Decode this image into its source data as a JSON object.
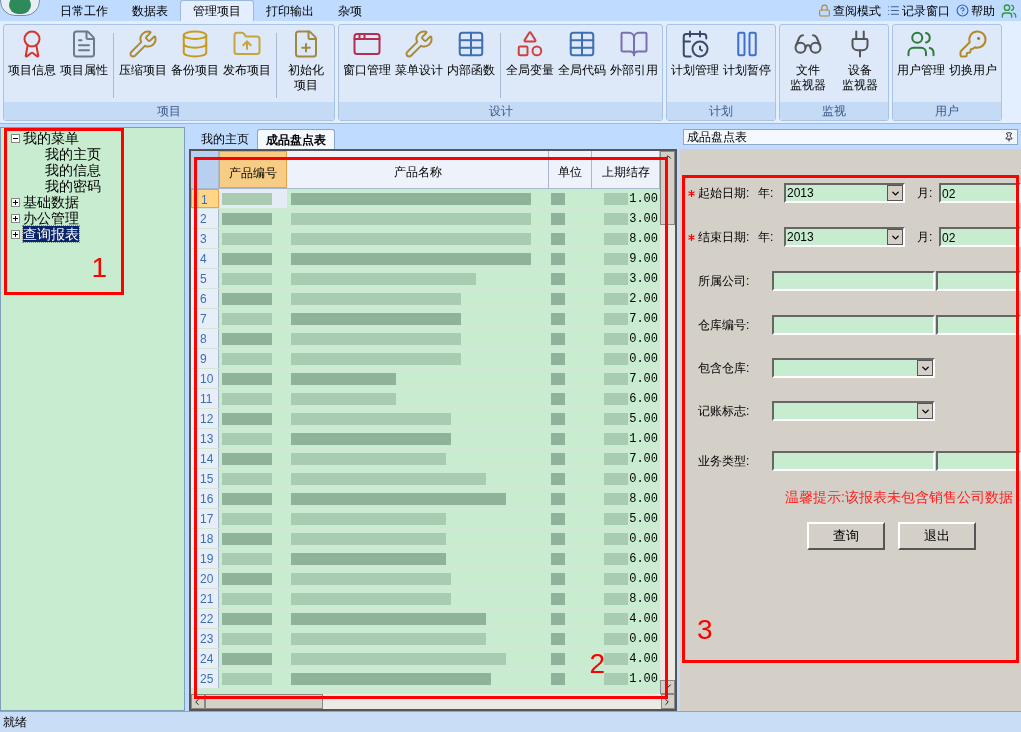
{
  "menu_tabs": [
    {
      "label": "日常工作",
      "selected": false
    },
    {
      "label": "数据表",
      "selected": false
    },
    {
      "label": "管理项目",
      "selected": true
    },
    {
      "label": "打印输出",
      "selected": false
    },
    {
      "label": "杂项",
      "selected": false
    }
  ],
  "top_links": [
    "查阅模式",
    "记录窗口",
    "帮助"
  ],
  "ribbon_groups": [
    {
      "label": "项目",
      "clusters": [
        [
          {
            "lines": [
              "项目信息"
            ]
          },
          {
            "lines": [
              "项目属性"
            ]
          }
        ],
        [
          {
            "lines": [
              "压缩项目"
            ]
          },
          {
            "lines": [
              "备份项目"
            ]
          },
          {
            "lines": [
              "发布项目"
            ]
          }
        ],
        [
          {
            "lines": [
              "初始化",
              "项目"
            ]
          }
        ]
      ]
    },
    {
      "label": "设计",
      "clusters": [
        [
          {
            "lines": [
              "窗口管理"
            ]
          },
          {
            "lines": [
              "菜单设计"
            ]
          },
          {
            "lines": [
              "内部函数"
            ]
          }
        ],
        [
          {
            "lines": [
              "全局变量"
            ]
          },
          {
            "lines": [
              "全局代码"
            ]
          },
          {
            "lines": [
              "外部引用"
            ]
          }
        ]
      ]
    },
    {
      "label": "计划",
      "clusters": [
        [
          {
            "lines": [
              "计划管理"
            ]
          },
          {
            "lines": [
              "计划暂停"
            ]
          }
        ]
      ]
    },
    {
      "label": "监视",
      "clusters": [
        [
          {
            "lines": [
              "文件",
              "监视器"
            ]
          },
          {
            "lines": [
              "设备",
              "监视器"
            ]
          }
        ]
      ]
    },
    {
      "label": "用户",
      "clusters": [
        [
          {
            "lines": [
              "用户管理"
            ]
          },
          {
            "lines": [
              "切换用户"
            ]
          }
        ]
      ]
    }
  ],
  "tree": [
    {
      "label": "我的菜单",
      "expanded": true,
      "selected": false,
      "children": [
        {
          "label": "我的主页",
          "selected": false
        },
        {
          "label": "我的信息",
          "selected": false
        },
        {
          "label": "我的密码",
          "selected": false
        }
      ]
    },
    {
      "label": "基础数据",
      "expanded": false,
      "selected": false
    },
    {
      "label": "办公管理",
      "expanded": false,
      "selected": false
    },
    {
      "label": "查询报表",
      "expanded": false,
      "selected": true
    }
  ],
  "doc_tabs": [
    {
      "label": "我的主页",
      "selected": false
    },
    {
      "label": "成品盘点表",
      "selected": true
    }
  ],
  "grid": {
    "columns": [
      "产品编号",
      "产品名称",
      "单位",
      "上期结存"
    ],
    "rows": [
      {
        "no": "1",
        "stock": "1.00",
        "selected": true
      },
      {
        "no": "2",
        "stock": "3.00",
        "selected": false
      },
      {
        "no": "3",
        "stock": "8.00",
        "selected": false
      },
      {
        "no": "4",
        "stock": "9.00",
        "selected": false
      },
      {
        "no": "5",
        "stock": "3.00",
        "selected": false
      },
      {
        "no": "6",
        "stock": "2.00",
        "selected": false
      },
      {
        "no": "7",
        "stock": "7.00",
        "selected": false
      },
      {
        "no": "8",
        "stock": "0.00",
        "selected": false
      },
      {
        "no": "9",
        "stock": "0.00",
        "selected": false
      },
      {
        "no": "10",
        "stock": "7.00",
        "selected": false
      },
      {
        "no": "11",
        "stock": "6.00",
        "selected": false
      },
      {
        "no": "12",
        "stock": "5.00",
        "selected": false
      },
      {
        "no": "13",
        "stock": "1.00",
        "selected": false
      },
      {
        "no": "14",
        "stock": "7.00",
        "selected": false
      },
      {
        "no": "15",
        "stock": "0.00",
        "selected": false
      },
      {
        "no": "16",
        "stock": "8.00",
        "selected": false
      },
      {
        "no": "17",
        "stock": "5.00",
        "selected": false
      },
      {
        "no": "18",
        "stock": "0.00",
        "selected": false
      },
      {
        "no": "19",
        "stock": "6.00",
        "selected": false
      },
      {
        "no": "20",
        "stock": "0.00",
        "selected": false
      },
      {
        "no": "21",
        "stock": "8.00",
        "selected": false
      },
      {
        "no": "22",
        "stock": "4.00",
        "selected": false
      },
      {
        "no": "23",
        "stock": "0.00",
        "selected": false
      },
      {
        "no": "24",
        "stock": "4.00",
        "selected": false
      },
      {
        "no": "25",
        "stock": "1.00",
        "selected": false
      }
    ]
  },
  "panel": {
    "title": "成品盘点表",
    "fields": [
      {
        "kind": "date",
        "label": "起始日期:",
        "required": true,
        "year_label": "年:",
        "year": "2013",
        "month_label": "月:",
        "month": "02"
      },
      {
        "kind": "date",
        "label": "结束日期:",
        "required": true,
        "year_label": "年:",
        "year": "2013",
        "month_label": "月:",
        "month": "02"
      },
      {
        "kind": "range",
        "label": "所属公司:"
      },
      {
        "kind": "range",
        "label": "仓库编号:"
      },
      {
        "kind": "select",
        "label": "包含仓库:"
      },
      {
        "kind": "select",
        "label": "记账标志:"
      },
      {
        "kind": "range",
        "label": "业务类型:"
      }
    ],
    "hint": "温馨提示:该报表未包含销售公司数据",
    "buttons": [
      "查询",
      "退出"
    ]
  },
  "status_bar": "就绪",
  "annotations": [
    "1",
    "2",
    "3"
  ]
}
